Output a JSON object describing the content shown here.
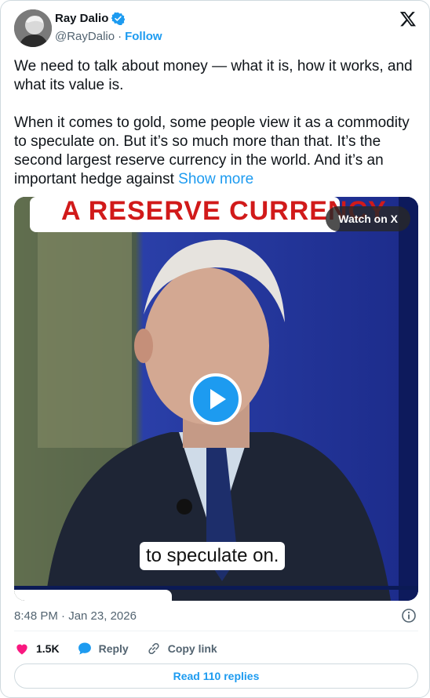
{
  "author": {
    "name": "Ray Dalio",
    "handle": "@RayDalio",
    "separator": "·",
    "follow_label": "Follow"
  },
  "tweet": {
    "text": "We need to talk about money — what it is, how it works, and what its value is.\n\nWhen it comes to gold, some people view it as a commodity to speculate on. But it’s so much more than that. It’s the second largest reserve currency in the world. And it’s an important hedge against ",
    "show_more": "Show more"
  },
  "media": {
    "banner_text": "A RESERVE CURRENCY",
    "watch_label": "Watch on X",
    "caption": "to speculate on.",
    "progress_fraction": 0.39
  },
  "meta": {
    "timestamp": "8:48 PM · Jan 23, 2026"
  },
  "actions": {
    "likes": "1.5K",
    "reply_label": "Reply",
    "copy_link_label": "Copy link"
  },
  "replies_button": "Read 110 replies",
  "colors": {
    "accent": "#1d9bf0",
    "like": "#f91880",
    "text_secondary": "#536471"
  },
  "icons": [
    "verified-icon",
    "x-logo-icon",
    "play-icon",
    "info-icon",
    "heart-icon",
    "reply-icon",
    "link-icon"
  ]
}
